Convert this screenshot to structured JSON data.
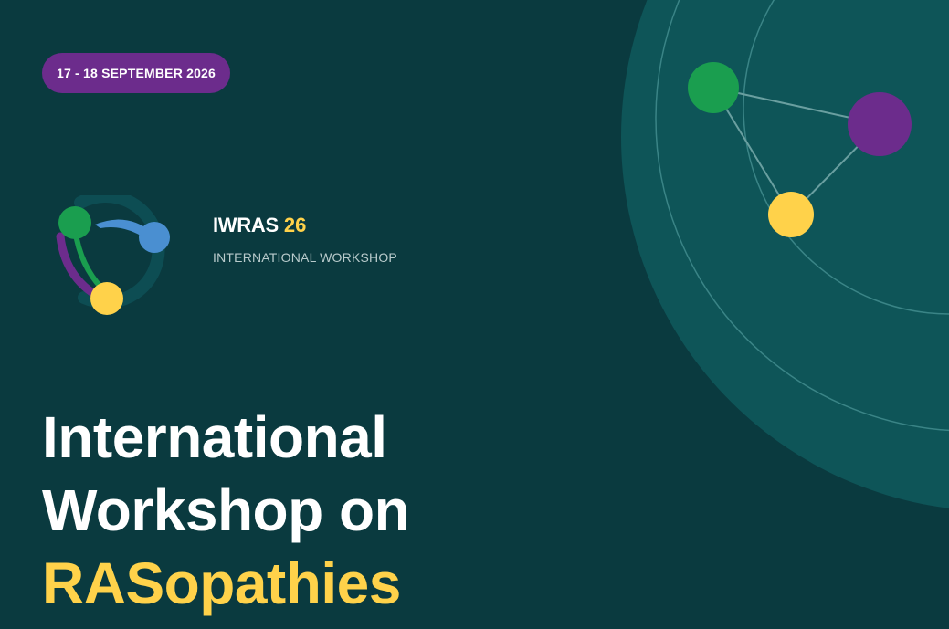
{
  "event": {
    "date_label": "17 - 18 SEPTEMBER 2026",
    "brand_name": "IWRAS",
    "brand_year": "26",
    "brand_subtitle": "INTERNATIONAL WORKSHOP",
    "title_line1": "International",
    "title_line2": "Workshop on",
    "title_line3": "RASopathies"
  },
  "colors": {
    "background": "#0a3a3f",
    "circle": "#0e5558",
    "purple": "#6c2c8c",
    "green": "#1a9e4f",
    "yellow": "#ffd24a",
    "blue": "#4a8fd1",
    "white": "#ffffff"
  },
  "icons": {
    "logo": "iwras-logo-icon",
    "decoration": "network-nodes-icon"
  }
}
